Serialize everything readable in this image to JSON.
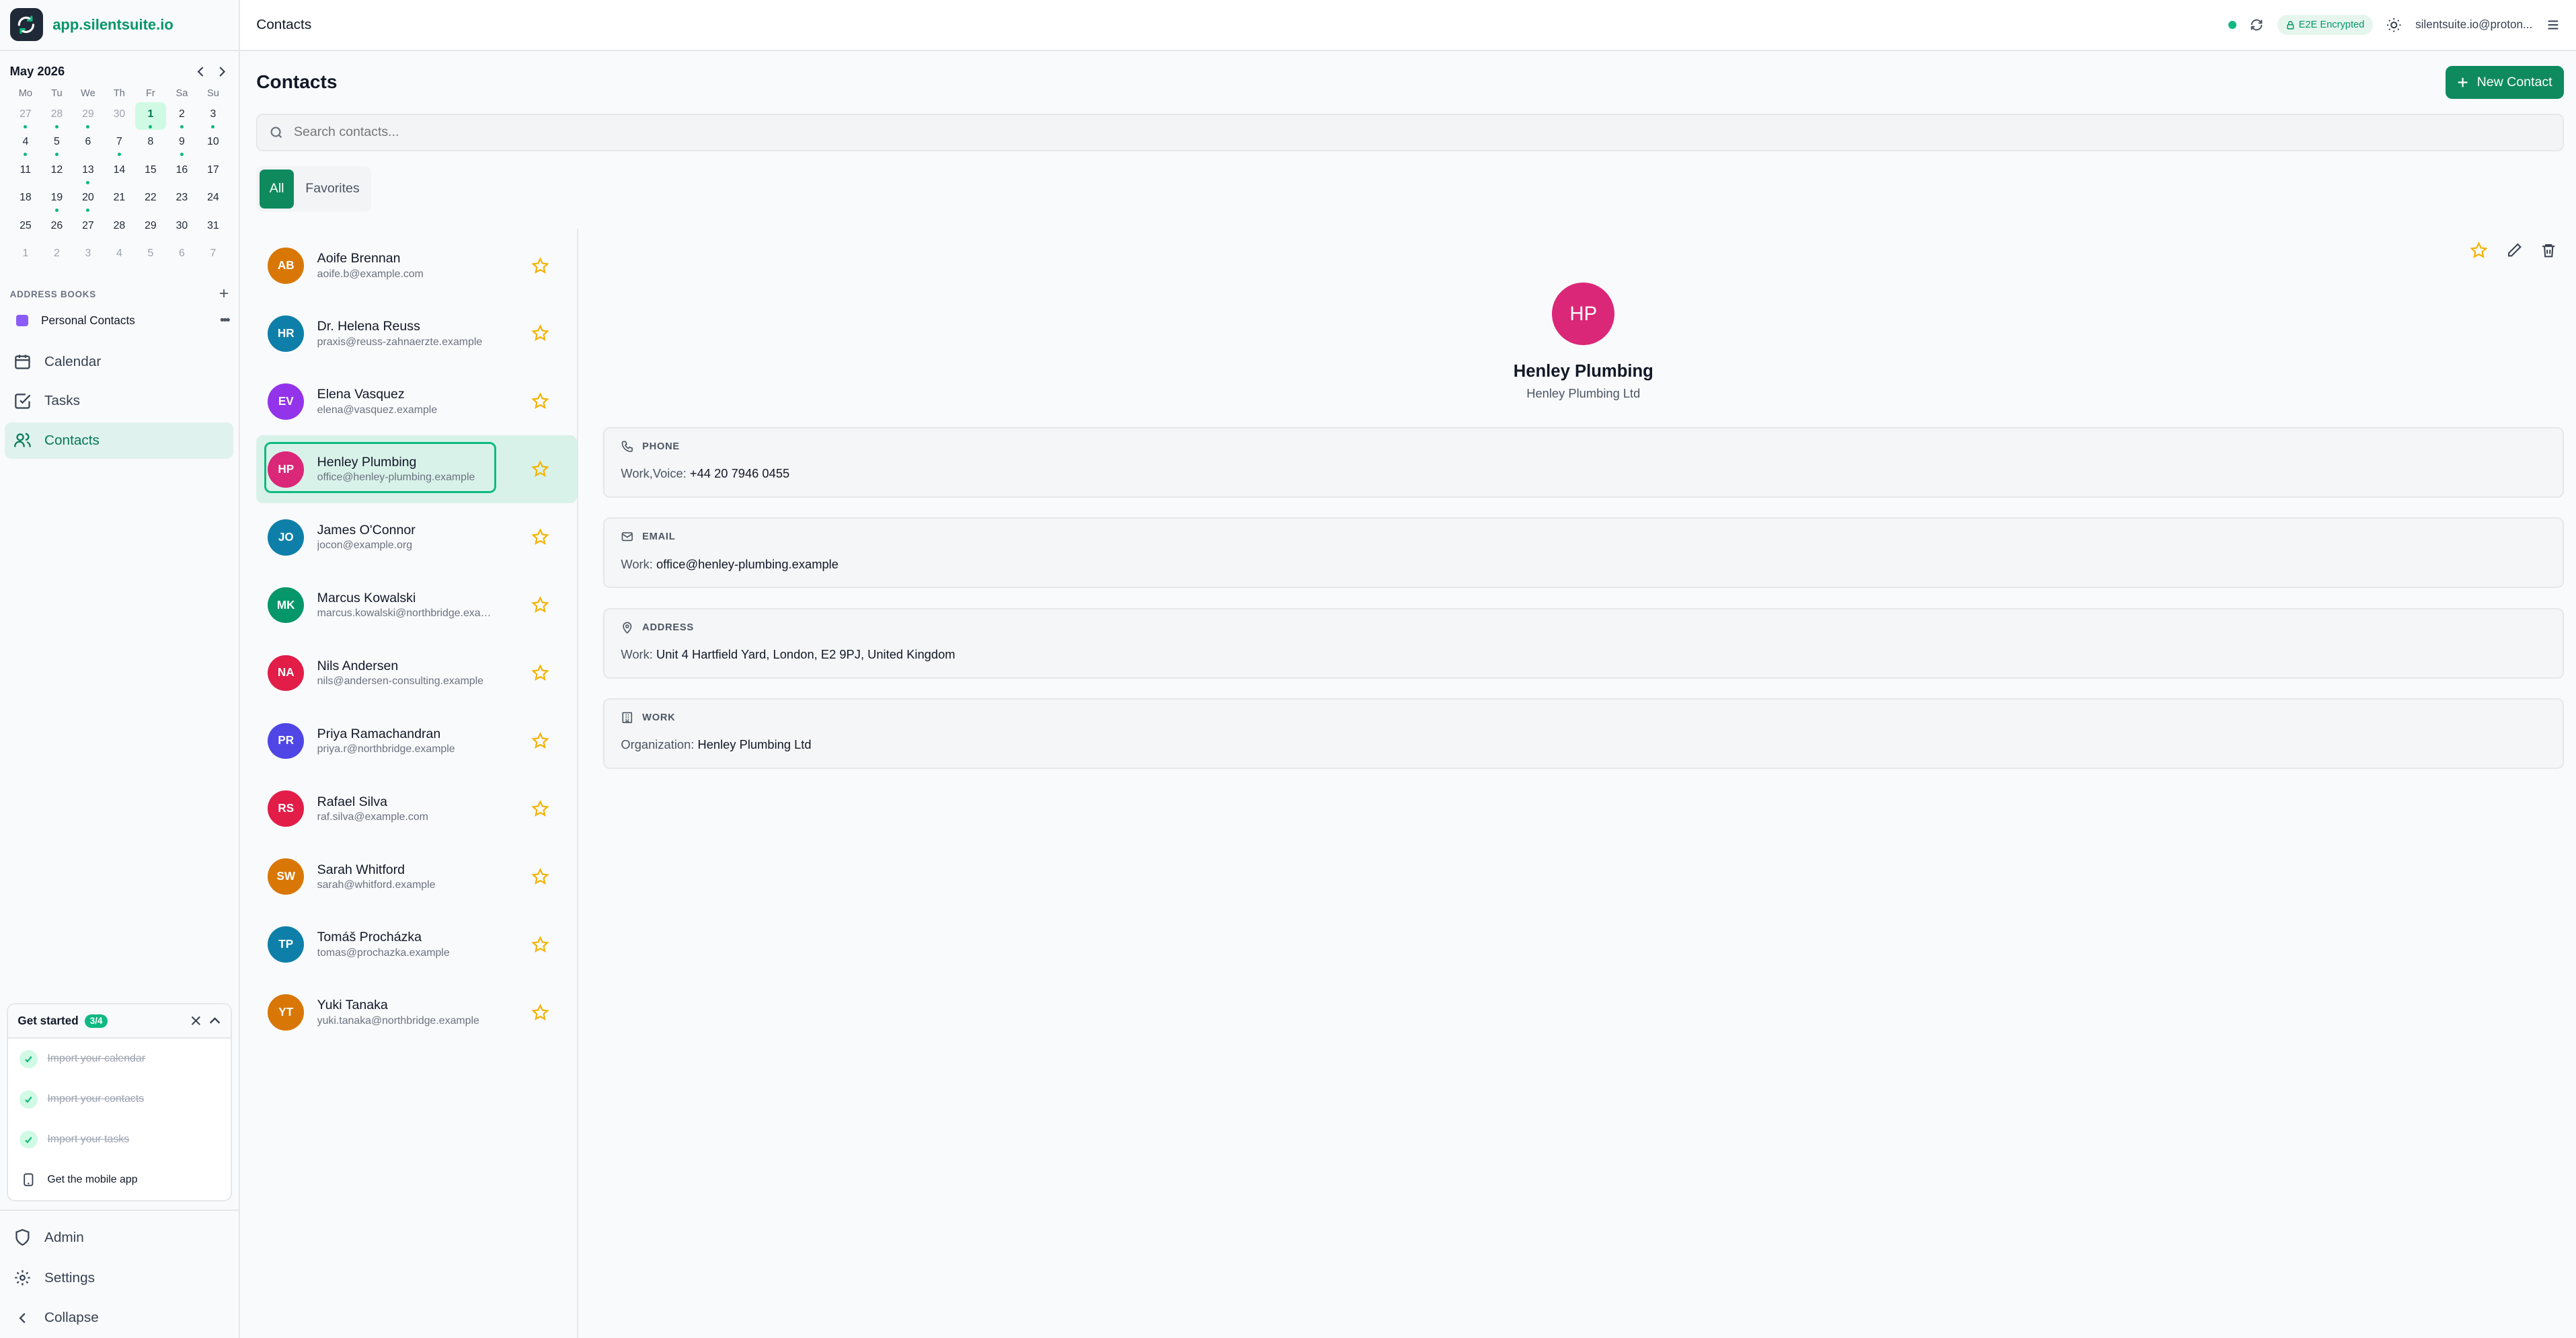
{
  "brand": {
    "name_prefix": "app.",
    "name_main": "silentsuite",
    "name_suffix": ".io"
  },
  "calendar": {
    "month": "May 2026",
    "dow": [
      "Mo",
      "Tu",
      "We",
      "Th",
      "Fr",
      "Sa",
      "Su"
    ],
    "days": [
      {
        "d": "27",
        "muted": true,
        "dot": true
      },
      {
        "d": "28",
        "muted": true,
        "dot": true
      },
      {
        "d": "29",
        "muted": true,
        "dot": true
      },
      {
        "d": "30",
        "muted": true
      },
      {
        "d": "1",
        "today": true,
        "dot": true
      },
      {
        "d": "2",
        "dot": true
      },
      {
        "d": "3",
        "dot": true
      },
      {
        "d": "4",
        "dot": true
      },
      {
        "d": "5",
        "dot": true
      },
      {
        "d": "6"
      },
      {
        "d": "7",
        "dot": true
      },
      {
        "d": "8"
      },
      {
        "d": "9",
        "dot": true
      },
      {
        "d": "10"
      },
      {
        "d": "11"
      },
      {
        "d": "12"
      },
      {
        "d": "13",
        "dot": true
      },
      {
        "d": "14"
      },
      {
        "d": "15"
      },
      {
        "d": "16"
      },
      {
        "d": "17"
      },
      {
        "d": "18"
      },
      {
        "d": "19",
        "dot": true
      },
      {
        "d": "20",
        "dot": true
      },
      {
        "d": "21"
      },
      {
        "d": "22"
      },
      {
        "d": "23"
      },
      {
        "d": "24"
      },
      {
        "d": "25"
      },
      {
        "d": "26"
      },
      {
        "d": "27"
      },
      {
        "d": "28"
      },
      {
        "d": "29"
      },
      {
        "d": "30"
      },
      {
        "d": "31"
      },
      {
        "d": "1",
        "muted": true
      },
      {
        "d": "2",
        "muted": true
      },
      {
        "d": "3",
        "muted": true
      },
      {
        "d": "4",
        "muted": true
      },
      {
        "d": "5",
        "muted": true
      },
      {
        "d": "6",
        "muted": true
      },
      {
        "d": "7",
        "muted": true
      }
    ]
  },
  "address_books": {
    "title": "ADDRESS BOOKS",
    "items": [
      {
        "label": "Personal Contacts",
        "color": "#8b5cf6"
      }
    ]
  },
  "nav": {
    "calendar": "Calendar",
    "tasks": "Tasks",
    "contacts": "Contacts"
  },
  "get_started": {
    "title": "Get started",
    "badge": "3/4",
    "items": [
      {
        "label": "Import your calendar",
        "done": true
      },
      {
        "label": "Import your contacts",
        "done": true
      },
      {
        "label": "Import your tasks",
        "done": true
      },
      {
        "label": "Get the mobile app",
        "done": false
      }
    ]
  },
  "bottom_nav": {
    "admin": "Admin",
    "settings": "Settings",
    "collapse": "Collapse"
  },
  "topbar": {
    "title": "Contacts",
    "e2e": "E2E Encrypted",
    "email": "silentsuite.io@proton..."
  },
  "page": {
    "title": "Contacts",
    "new_button": "New Contact",
    "search_placeholder": "Search contacts..."
  },
  "tabs": {
    "all": "All",
    "favorites": "Favorites"
  },
  "contacts": [
    {
      "initials": "AB",
      "name": "Aoife Brennan",
      "email": "aoife.b@example.com",
      "color": "#d97706"
    },
    {
      "initials": "HR",
      "name": "Dr. Helena Reuss",
      "email": "praxis@reuss-zahnaerzte.example",
      "color": "#0e7fa8"
    },
    {
      "initials": "EV",
      "name": "Elena Vasquez",
      "email": "elena@vasquez.example",
      "color": "#9333ea"
    },
    {
      "initials": "HP",
      "name": "Henley Plumbing",
      "email": "office@henley-plumbing.example",
      "color": "#db2777",
      "selected": true
    },
    {
      "initials": "JO",
      "name": "James O'Connor",
      "email": "jocon@example.org",
      "color": "#0e7fa8"
    },
    {
      "initials": "MK",
      "name": "Marcus Kowalski",
      "email": "marcus.kowalski@northbridge.example",
      "color": "#059669"
    },
    {
      "initials": "NA",
      "name": "Nils Andersen",
      "email": "nils@andersen-consulting.example",
      "color": "#e11d48"
    },
    {
      "initials": "PR",
      "name": "Priya Ramachandran",
      "email": "priya.r@northbridge.example",
      "color": "#4f46e5"
    },
    {
      "initials": "RS",
      "name": "Rafael Silva",
      "email": "raf.silva@example.com",
      "color": "#e11d48"
    },
    {
      "initials": "SW",
      "name": "Sarah Whitford",
      "email": "sarah@whitford.example",
      "color": "#d97706"
    },
    {
      "initials": "TP",
      "name": "Tomáš Procházka",
      "email": "tomas@prochazka.example",
      "color": "#0e7fa8"
    },
    {
      "initials": "YT",
      "name": "Yuki Tanaka",
      "email": "yuki.tanaka@northbridge.example",
      "color": "#d97706"
    }
  ],
  "detail": {
    "initials": "HP",
    "name": "Henley Plumbing",
    "org": "Henley Plumbing Ltd",
    "phone": {
      "label": "PHONE",
      "key": "Work,Voice:",
      "value": "+44 20 7946 0455"
    },
    "email": {
      "label": "EMAIL",
      "key": "Work:",
      "value": "office@henley-plumbing.example"
    },
    "address": {
      "label": "ADDRESS",
      "key": "Work:",
      "value": "Unit 4 Hartfield Yard, London, E2 9PJ, United Kingdom"
    },
    "work": {
      "label": "WORK",
      "key": "Organization:",
      "value": "Henley Plumbing Ltd"
    }
  },
  "colors": {
    "accent": "#0f8a5f",
    "accent_light": "#d1fae5",
    "star": "#f5b301"
  }
}
